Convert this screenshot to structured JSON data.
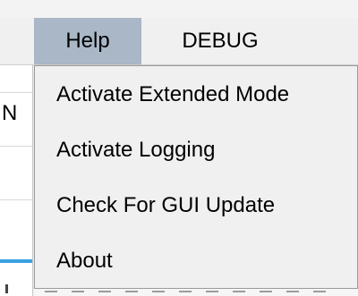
{
  "menubar": {
    "items": [
      {
        "label": "Help"
      },
      {
        "label": "DEBUG"
      }
    ]
  },
  "help_menu": {
    "items": [
      {
        "label": "Activate Extended Mode"
      },
      {
        "label": "Activate Logging"
      },
      {
        "label": "Check For GUI Update"
      },
      {
        "label": "About"
      }
    ]
  },
  "background": {
    "left_glyph": "N"
  },
  "colors": {
    "menu_highlight": "#a9b7c6",
    "menu_background": "#f0f0f0",
    "accent_bar": "#3aa0e0"
  }
}
